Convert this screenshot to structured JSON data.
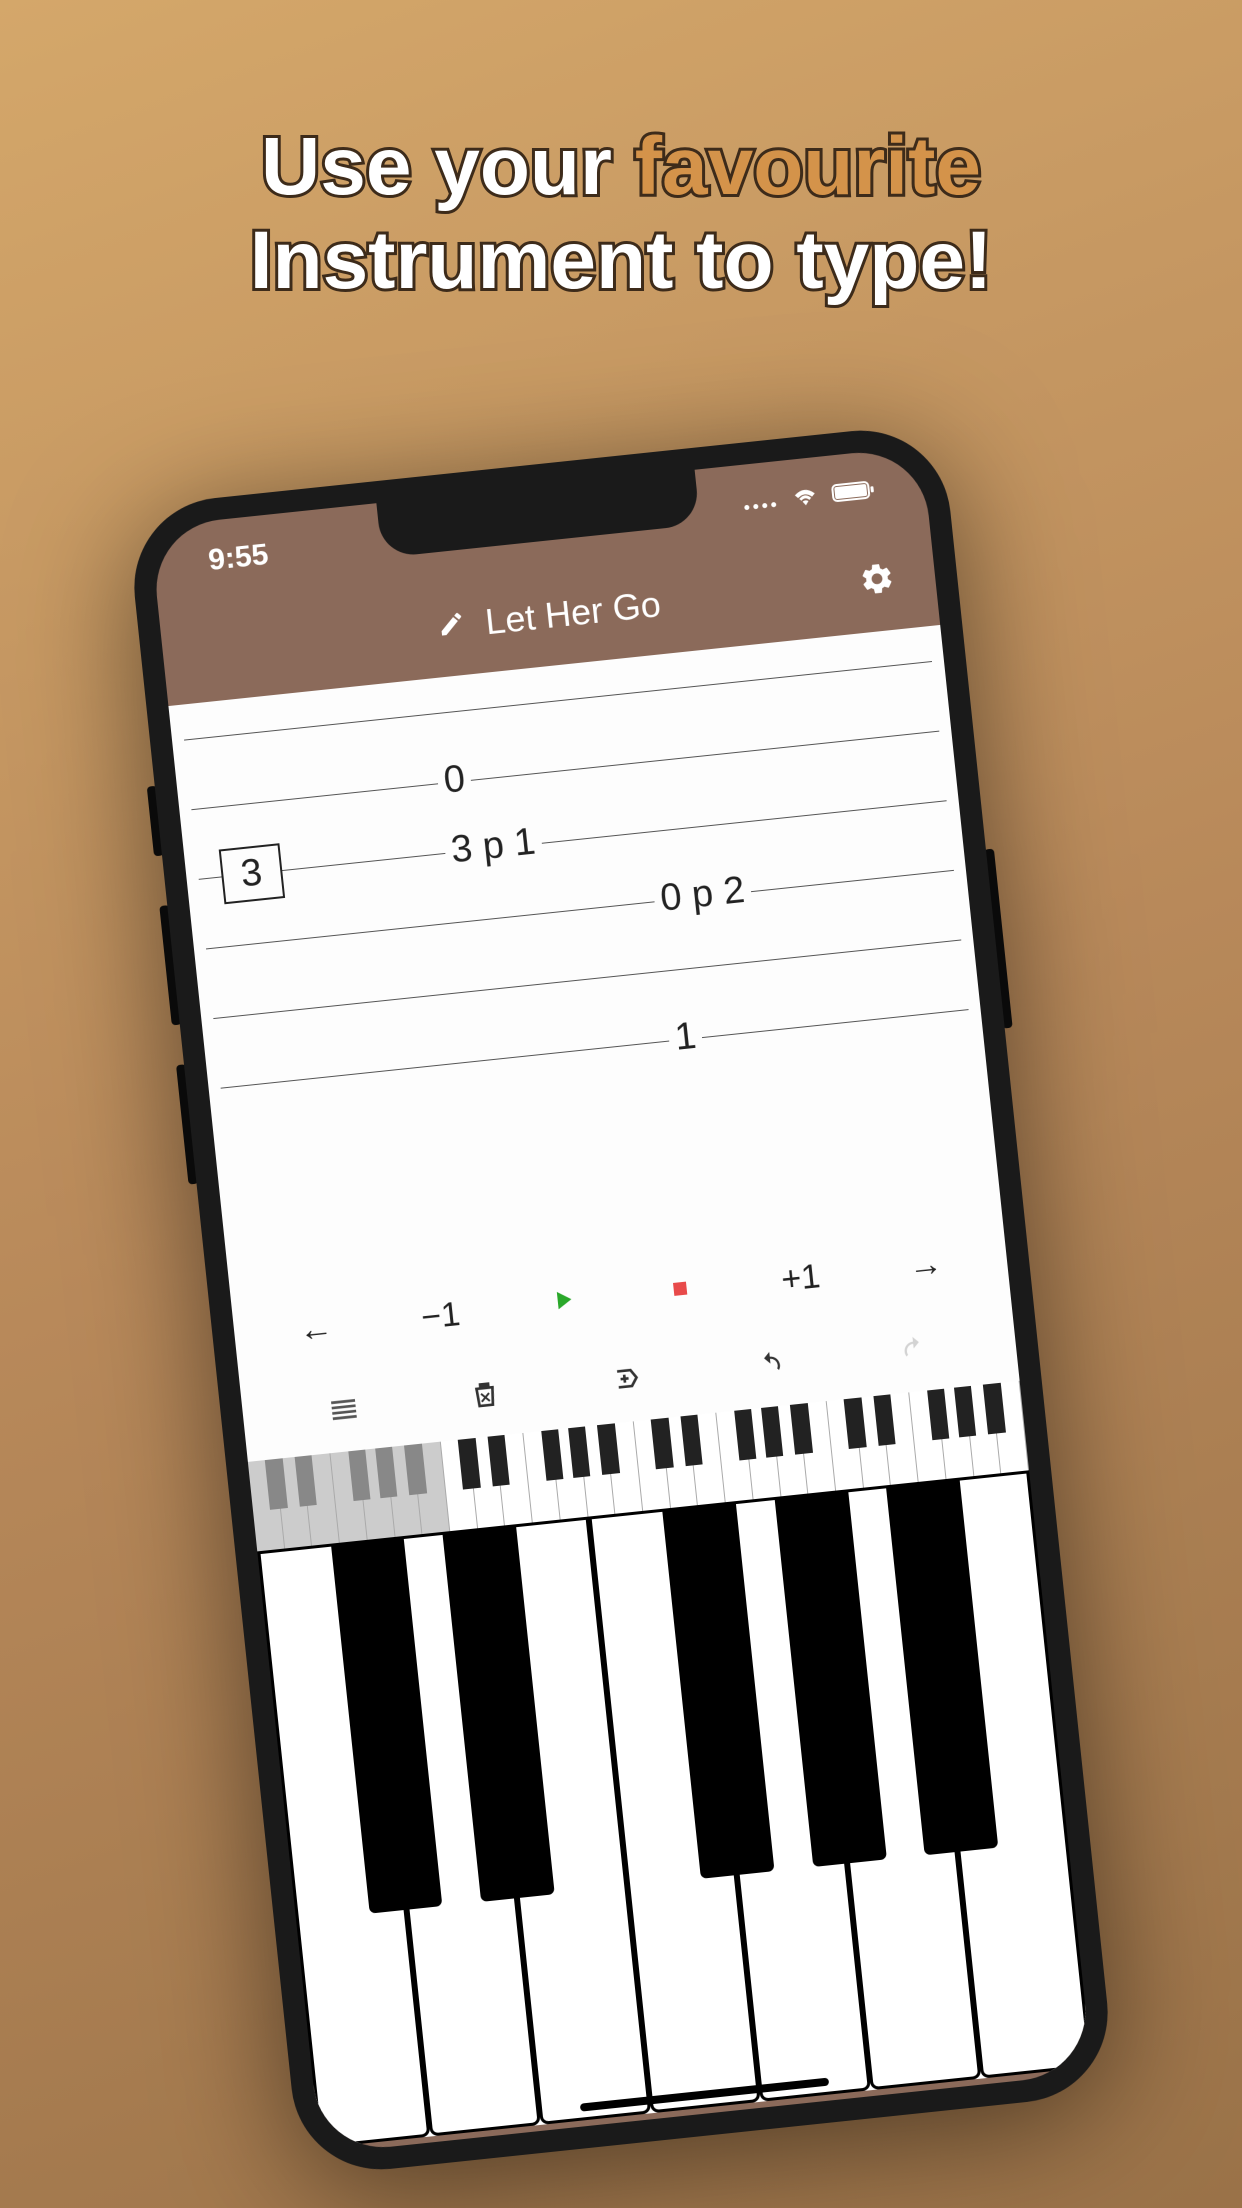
{
  "marketing": {
    "line1a": "Use your ",
    "line1b": "favourite",
    "line2": "Instrument to type!"
  },
  "status": {
    "time": "9:55"
  },
  "header": {
    "title": "Let Her Go"
  },
  "tab": {
    "strings": [
      {
        "notes": []
      },
      {
        "notes": [
          {
            "pos": 33,
            "text": "0"
          }
        ]
      },
      {
        "notes": [
          {
            "pos": 3,
            "text": "3",
            "selected": true
          },
          {
            "pos": 33,
            "text": "3 p 1"
          }
        ]
      },
      {
        "notes": [
          {
            "pos": 60,
            "text": "0 p 2"
          }
        ]
      },
      {
        "notes": []
      },
      {
        "notes": [
          {
            "pos": 60,
            "text": "1"
          }
        ]
      }
    ]
  },
  "controls": {
    "prev_arrow": "←",
    "minus": "−1",
    "plus": "+1",
    "next_arrow": "→"
  }
}
